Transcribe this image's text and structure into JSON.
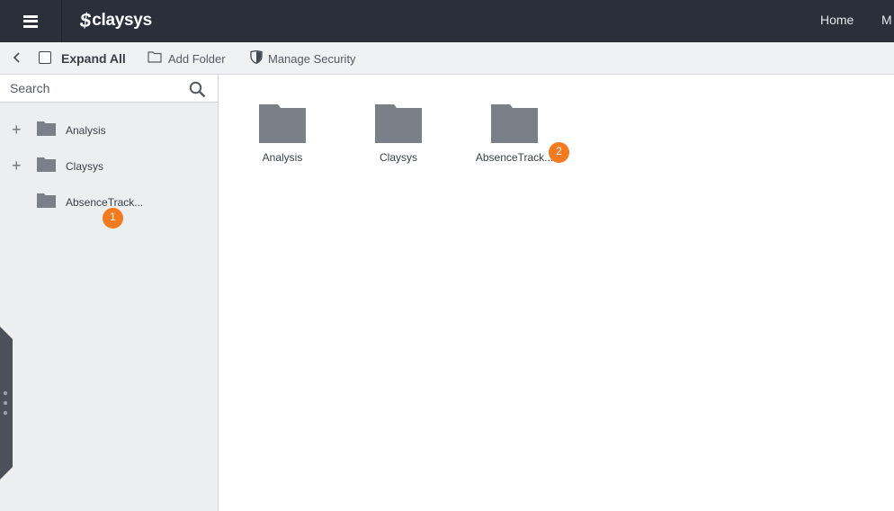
{
  "header": {
    "logo_text": "claysys",
    "nav": {
      "home": "Home",
      "more": "M"
    }
  },
  "toolbar": {
    "expand_all_label": "Expand All",
    "expand_all_checked": false,
    "add_folder_label": "Add Folder",
    "manage_security_label": "Manage Security"
  },
  "sidebar": {
    "search": {
      "placeholder": "Search",
      "value": ""
    },
    "tree": [
      {
        "label": "Analysis",
        "expandable": true,
        "expand_symbol": "+"
      },
      {
        "label": "Claysys",
        "expandable": true,
        "expand_symbol": "+"
      },
      {
        "label": "AbsenceTrack...",
        "expandable": false,
        "expand_symbol": ""
      }
    ]
  },
  "main": {
    "folders": [
      {
        "label": "Analysis"
      },
      {
        "label": "Claysys"
      },
      {
        "label": "AbsenceTrack..."
      }
    ]
  },
  "annotations": {
    "badge_1": "1",
    "badge_2": "2"
  },
  "colors": {
    "topbar": "#2a2f3a",
    "folder": "#7b7f88",
    "badge": "#f47a20",
    "sidebar": "#edeef0"
  },
  "icons": [
    "menu-icon",
    "back-chevron-icon",
    "folder-outline-icon",
    "shield-icon",
    "search-icon",
    "folder-icon"
  ]
}
